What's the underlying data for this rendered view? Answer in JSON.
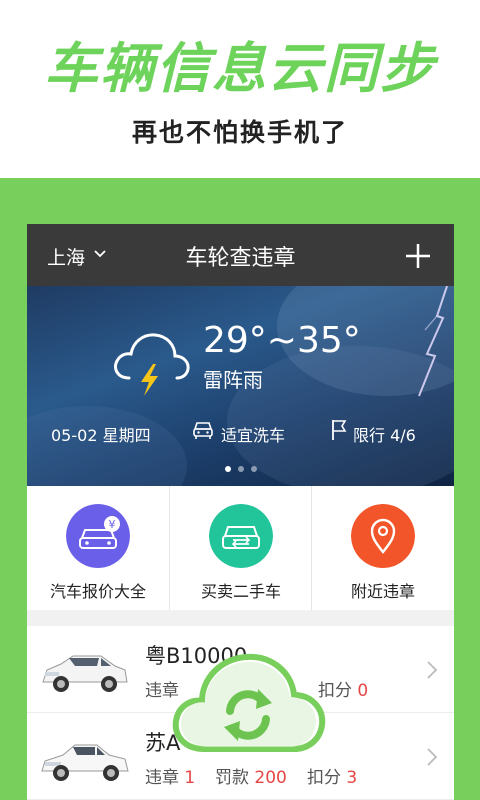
{
  "promo": {
    "title": "车辆信息云同步",
    "subtitle": "再也不怕换手机了"
  },
  "titlebar": {
    "city": "上海",
    "app_title": "车轮查违章",
    "add_icon": "plus-icon",
    "city_icon": "chevron-down-icon"
  },
  "weather": {
    "temperature": "29°~35°",
    "condition": "雷阵雨",
    "date": "05-02 星期四",
    "wash": "适宜洗车",
    "limit": "限行 4/6",
    "page_index": 1,
    "page_count": 3,
    "icon": "thunderstorm-icon"
  },
  "services": [
    {
      "label": "汽车报价大全",
      "icon": "car-price-icon",
      "color": "#6a5fe8"
    },
    {
      "label": "买卖二手车",
      "icon": "used-car-icon",
      "color": "#22c49a"
    },
    {
      "label": "附近违章",
      "icon": "location-pin-icon",
      "color": "#f2552a"
    }
  ],
  "cars": [
    {
      "plate": "粤B10000",
      "violation_label": "违章",
      "violation": "",
      "fine_label": "",
      "fine": "",
      "points_label": "扣分",
      "points": "0"
    },
    {
      "plate": "苏A",
      "violation_label": "违章",
      "violation": "1",
      "fine_label": "罚款",
      "fine": "200",
      "points_label": "扣分",
      "points": "3"
    }
  ],
  "colors": {
    "accent_green": "#78cf5b",
    "title_green": "#6dd35a",
    "warning_red": "#e64545",
    "titlebar": "#3a3a3a"
  }
}
